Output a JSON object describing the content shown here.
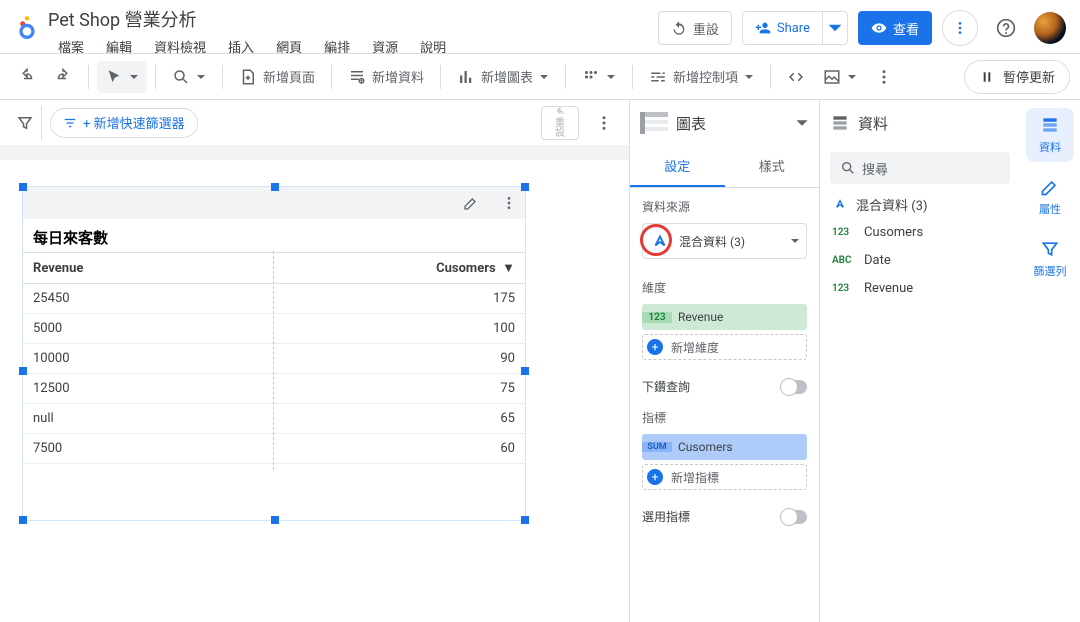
{
  "app": {
    "title": "Pet Shop 營業分析",
    "menus": [
      "檔案",
      "編輯",
      "資料檢視",
      "插入",
      "網頁",
      "編排",
      "資源",
      "說明"
    ]
  },
  "appbar": {
    "reset": "重設",
    "share": "Share",
    "view": "查看"
  },
  "toolbar": {
    "add_page": "新增頁面",
    "add_data": "新增資料",
    "add_chart": "新增圖表",
    "add_control": "新增控制項",
    "pause": "暫停更新"
  },
  "canvas": {
    "quick_filter": "+ 新增快速篩選器",
    "reset_lines": [
      "重",
      "設"
    ],
    "component": {
      "title": "每日來客數",
      "columns": [
        "Revenue",
        "Cusomers"
      ],
      "rows": [
        {
          "revenue": "25450",
          "customers": "175"
        },
        {
          "revenue": "5000",
          "customers": "100"
        },
        {
          "revenue": "10000",
          "customers": "90"
        },
        {
          "revenue": "12500",
          "customers": "75"
        },
        {
          "revenue": "null",
          "customers": "65"
        },
        {
          "revenue": "7500",
          "customers": "60"
        }
      ]
    }
  },
  "panel_chart": {
    "header": "圖表",
    "tabs": {
      "setup": "設定",
      "style": "樣式"
    },
    "datasource_label": "資料來源",
    "datasource_name": "混合資料 (3)",
    "dimension_label": "維度",
    "dimension_name": "Revenue",
    "add_dimension": "新增維度",
    "drilldown": "下鑽查詢",
    "metric_label": "指標",
    "metric_name": "Cusomers",
    "add_metric": "新增指標",
    "optional_metric": "選用指標"
  },
  "panel_data": {
    "header": "資料",
    "search_ph": "搜尋",
    "source": "混合資料 (3)",
    "fields": [
      {
        "type": "123",
        "name": "Cusomers",
        "cls": "num"
      },
      {
        "type": "ABC",
        "name": "Date",
        "cls": "txt"
      },
      {
        "type": "123",
        "name": "Revenue",
        "cls": "num"
      }
    ]
  },
  "rail": {
    "data": "資料",
    "props": "屬性",
    "filter": "篩選列"
  }
}
